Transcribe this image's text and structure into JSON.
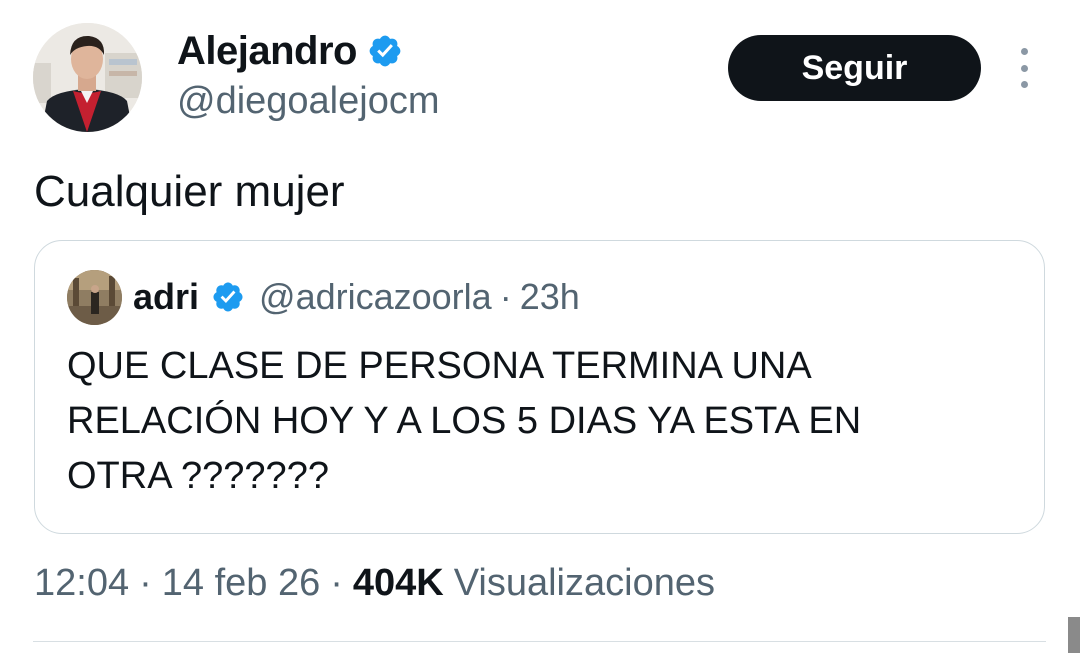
{
  "author": {
    "name": "Alejandro",
    "handle": "@diegoalejocm",
    "avatar_icon": "profile-photo"
  },
  "follow_button": {
    "label": "Seguir"
  },
  "more_menu_icon": "more-vertical-icon",
  "tweet": {
    "text": "Cualquier mujer"
  },
  "quoted_tweet": {
    "name": "adri",
    "handle": "@adricazoorla",
    "separator": "·",
    "time": "23h",
    "lines": [
      "QUE CLASE DE PERSONA TERMINA UNA",
      "RELACIÓN HOY Y A LOS 5 DIAS YA ESTA EN",
      "OTRA ???????"
    ]
  },
  "meta": {
    "time": "12:04",
    "separator": "·",
    "date": "14 feb 26",
    "views_count": "404K",
    "views_label": "Visualizaciones"
  },
  "colors": {
    "verified": "#1d9bf0",
    "primary_text": "#0f1419",
    "secondary_text": "#536471",
    "border": "#cfd9de"
  }
}
